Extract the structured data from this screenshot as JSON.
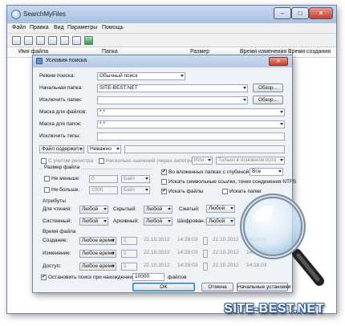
{
  "window": {
    "title": "SearchMyFiles",
    "minimize": "–",
    "maximize": "□",
    "close": "✕"
  },
  "menu": [
    "Файл",
    "Правка",
    "Вид",
    "Параметры",
    "Помощь"
  ],
  "columns": [
    "Имя файла",
    "Папка",
    "Размер",
    "Время изменения",
    "Время создания"
  ],
  "dialog": {
    "title": "Условия поиска",
    "close": "✕",
    "mode_label": "Режим поиска:",
    "mode_value": "Обычный поиск",
    "start_folder_label": "Начальная папка:",
    "start_folder_value": "SITE-BEST.NET",
    "exclude_folders_label": "Исключить папки:",
    "file_mask_label": "Маска для файлов:",
    "file_mask_value": "*.*",
    "folder_mask_label": "Маска для папок:",
    "folder_mask_value": "*.*",
    "exclude_types_label": "Исключить типы:",
    "browse_label": "Обзор...",
    "contains_select": "Файл содержит...",
    "contains_mode": "Неважно",
    "case_label": "С учетом регистра",
    "multiple_label": "Несколько значений (через запятую)",
    "or_value": "Или",
    "main_stream_value": "Только в основном пото",
    "size_group": "Размер файла",
    "not_less_label": "Не меньше:",
    "not_less_value": "0",
    "not_more_label": "Не больше:",
    "not_more_value": "1000",
    "byte_unit": "Байт",
    "subfolders_label": "Во вложенных папках с глубиной:",
    "subfolders_value": "Все",
    "symlinks_label": "Искать символьные ссылки, точки соединения NTFS",
    "search_files_label": "Искать файлы",
    "search_folders_label": "Искать папки",
    "attributes_group": "Атрибуты",
    "read_only_label": "Для чтения:",
    "hidden_label": "Скрытый:",
    "compressed_label": "Сжатый:",
    "system_label": "Системный:",
    "archive_label": "Архивный:",
    "encrypted_label": "Шифрован.:",
    "any_value": "Любой",
    "time_group": "Время файла",
    "created_label": "Создание:",
    "modified_label": "Изменение:",
    "accessed_label": "Доступ:",
    "any_time": "Любое время",
    "count_value": "1",
    "date_value": "22.10.2012",
    "time_value": "14:28:03",
    "stop_label": "Остановить поиск при нахождении",
    "stop_value": "10000",
    "stop_suffix": "файлов",
    "ok_label": "OK",
    "cancel_label": "Отмена",
    "defaults_label": "Начальные установки"
  },
  "watermark": "SITE-BEST.NET",
  "accent": "#3c7fb1"
}
